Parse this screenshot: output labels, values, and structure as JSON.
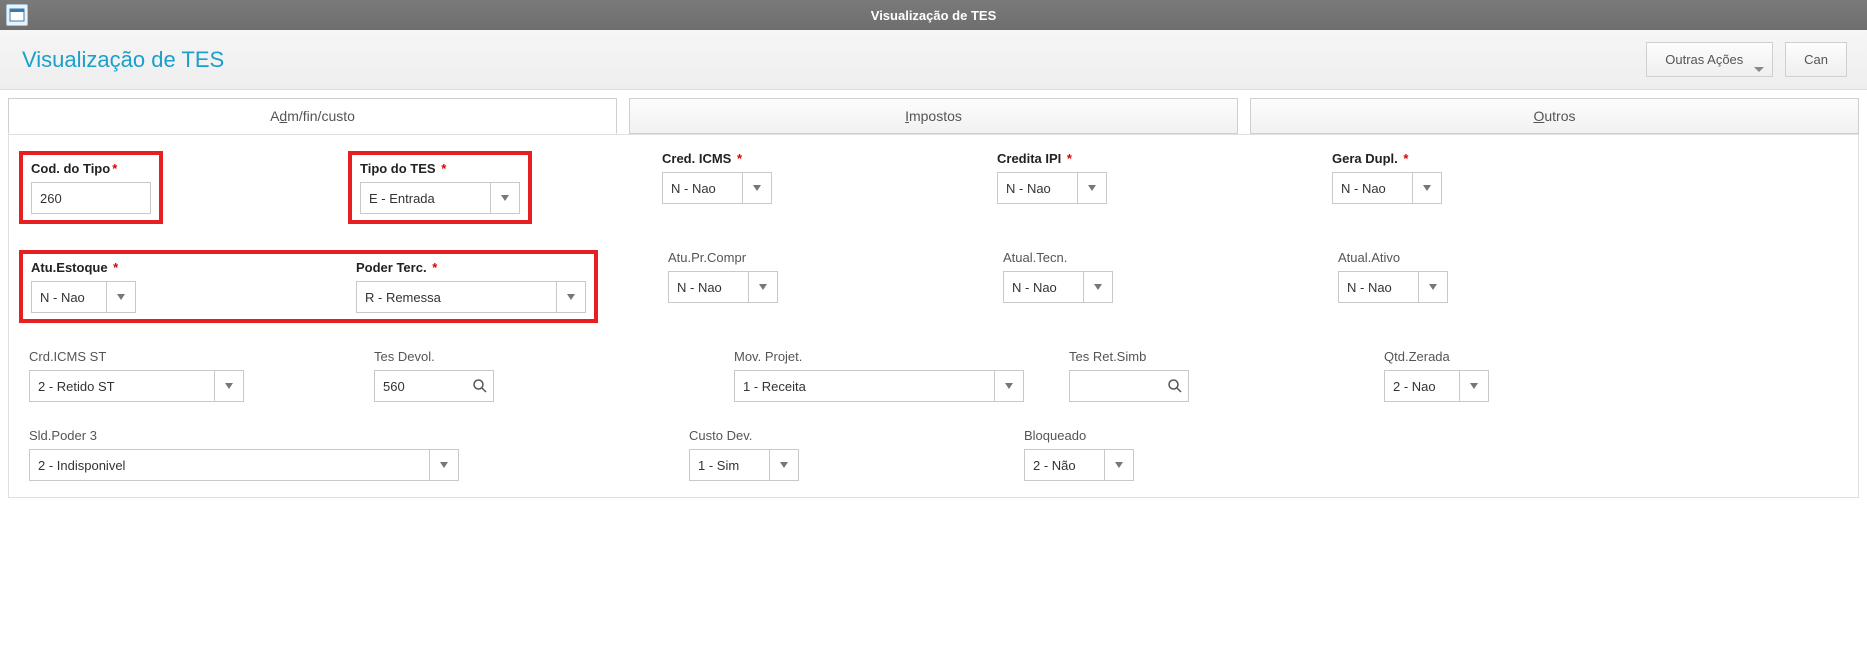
{
  "window": {
    "title": "Visualização de TES"
  },
  "header": {
    "title": "Visualização de TES",
    "btn_other_actions": "Outras Ações",
    "btn_cancel": "Can"
  },
  "tabs": {
    "adm_prefix": "A",
    "adm_mn": "d",
    "adm_suffix": "m/fin/custo",
    "imp_mn": "I",
    "imp_suffix": "mpostos",
    "out_mn": "O",
    "out_suffix": "utros"
  },
  "labels": {
    "cod_tipo": "Cod. do Tipo",
    "tipo_tes": "Tipo do TES ",
    "cred_icms": "Cred. ICMS ",
    "credita_ipi": "Credita IPI ",
    "gera_dupl": "Gera Dupl. ",
    "atu_estoque": "Atu.Estoque ",
    "poder_terc": "Poder Terc. ",
    "atu_pr_compr": "Atu.Pr.Compr",
    "atual_tecn": "Atual.Tecn.",
    "atual_ativo": "Atual.Ativo",
    "crd_icms_st": "Crd.ICMS ST",
    "tes_devol": "Tes Devol.",
    "mov_projet": "Mov. Projet.",
    "tes_ret_simb": "Tes Ret.Simb",
    "qtd_zerada": "Qtd.Zerada",
    "sld_poder3": "Sld.Poder 3",
    "custo_dev": "Custo Dev.",
    "bloqueado": "Bloqueado"
  },
  "values": {
    "cod_tipo": "260",
    "tipo_tes": "E - Entrada",
    "cred_icms": "N - Nao",
    "credita_ipi": "N - Nao",
    "gera_dupl": "N - Nao",
    "atu_estoque": "N - Nao",
    "poder_terc": "R - Remessa",
    "atu_pr_compr": "N - Nao",
    "atual_tecn": "N - Nao",
    "atual_ativo": "N - Nao",
    "crd_icms_st": "2 - Retido ST",
    "tes_devol": "560",
    "mov_projet": "1 - Receita",
    "tes_ret_simb": "",
    "qtd_zerada": "2 - Nao",
    "sld_poder3": "2 - Indisponivel",
    "custo_dev": "1 - Sim",
    "bloqueado": "2 - Não"
  }
}
